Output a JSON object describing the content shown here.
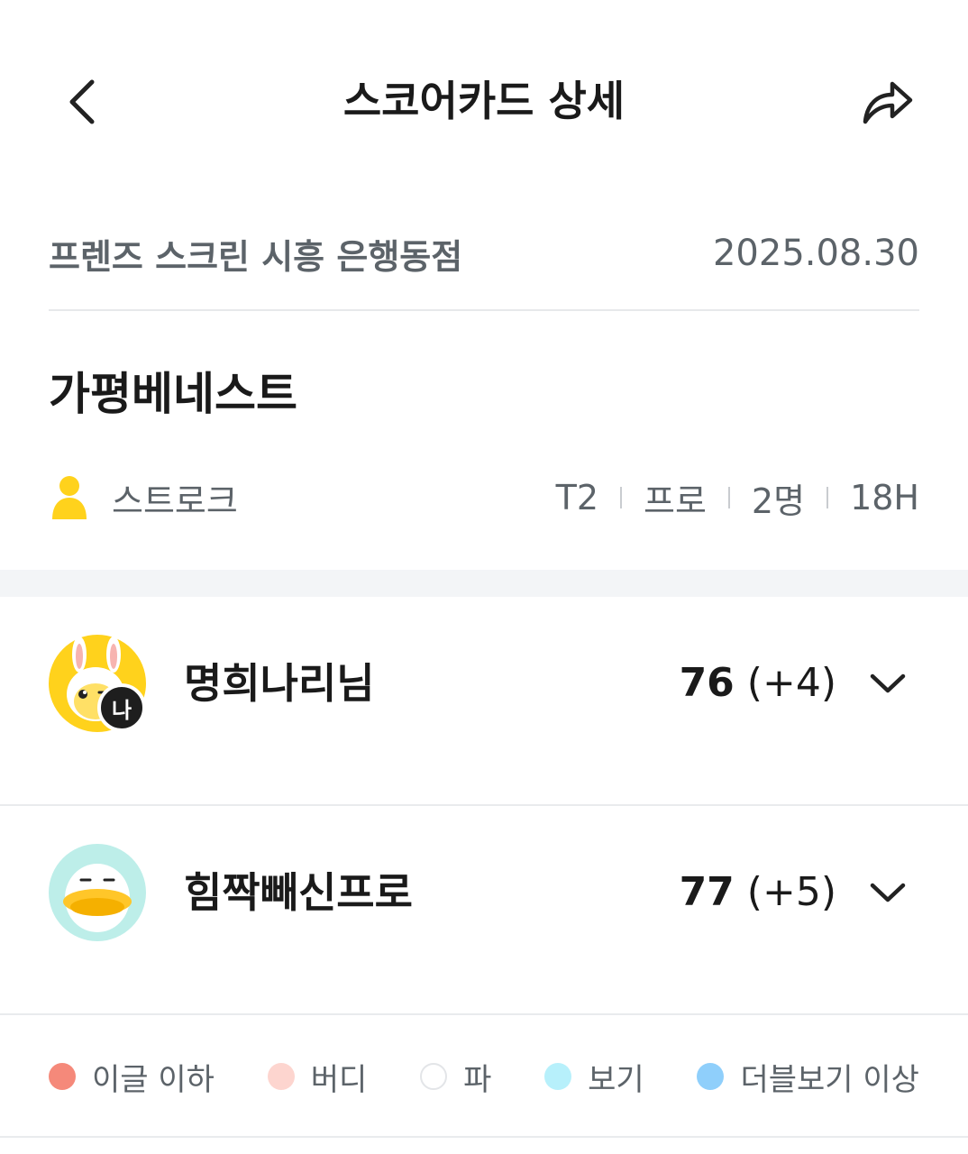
{
  "header": {
    "title": "스코어카드 상세",
    "back_icon": "chevron-left-icon",
    "share_icon": "share-arrow-icon"
  },
  "round": {
    "venue": "프렌즈 스크린 시흥 은행동점",
    "date": "2025.08.30",
    "course": "가평베네스트",
    "mode": "스트로크",
    "meta": [
      "T2",
      "프로",
      "2명",
      "18H"
    ]
  },
  "players": [
    {
      "name": "명희나리님",
      "strokes": "76",
      "diff": "(+4)",
      "me_badge": "나"
    },
    {
      "name": "힘짝빼신프로",
      "strokes": "77",
      "diff": "(+5)"
    }
  ],
  "legend": [
    {
      "label": "이글 이하",
      "color": "#f5897a"
    },
    {
      "label": "버디",
      "color": "#fdd5cf"
    },
    {
      "label": "파",
      "color": "#ffffff"
    },
    {
      "label": "보기",
      "color": "#b7f0fb"
    },
    {
      "label": "더블보기 이상",
      "color": "#8fcffb"
    }
  ],
  "colors": {
    "accent_yellow": "#ffd21c",
    "text_secondary": "#5c6369",
    "band": "#f3f5f7"
  }
}
